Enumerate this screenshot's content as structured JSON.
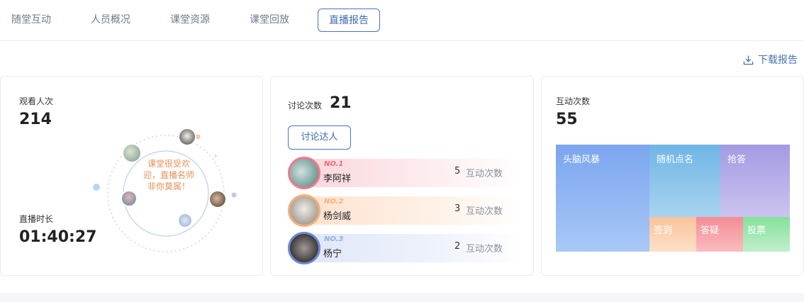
{
  "tabs": [
    {
      "label": "随堂互动"
    },
    {
      "label": "人员概况"
    },
    {
      "label": "课堂资源"
    },
    {
      "label": "课堂回放"
    },
    {
      "label": "直播报告",
      "active": true
    }
  ],
  "download": {
    "label": "下载报告",
    "icon": "download-icon"
  },
  "views": {
    "label": "观看人次",
    "value": "214",
    "duration_label": "直播时长",
    "duration": "01:40:27",
    "center_text": "课堂很受欢迎，直播名师非你莫属！"
  },
  "discussion": {
    "label": "讨论次数",
    "value": "21",
    "button": "讨论达人",
    "ranking": [
      {
        "no": "NO.1",
        "name": "李阿祥",
        "count": "5",
        "unit": "互动次数",
        "color": "#f0798a"
      },
      {
        "no": "NO.2",
        "name": "杨剑威",
        "count": "3",
        "unit": "互动次数",
        "color": "#f5b07a"
      },
      {
        "no": "NO.3",
        "name": "杨宁",
        "count": "2",
        "unit": "互动次数",
        "color": "#6f86d6"
      }
    ]
  },
  "interaction": {
    "label": "互动次数",
    "value": "55",
    "treemap": [
      {
        "label": "头脑风暴"
      },
      {
        "label": "随机点名"
      },
      {
        "label": "抢答"
      },
      {
        "label": "签到"
      },
      {
        "label": "答疑"
      },
      {
        "label": "投票"
      }
    ]
  }
}
